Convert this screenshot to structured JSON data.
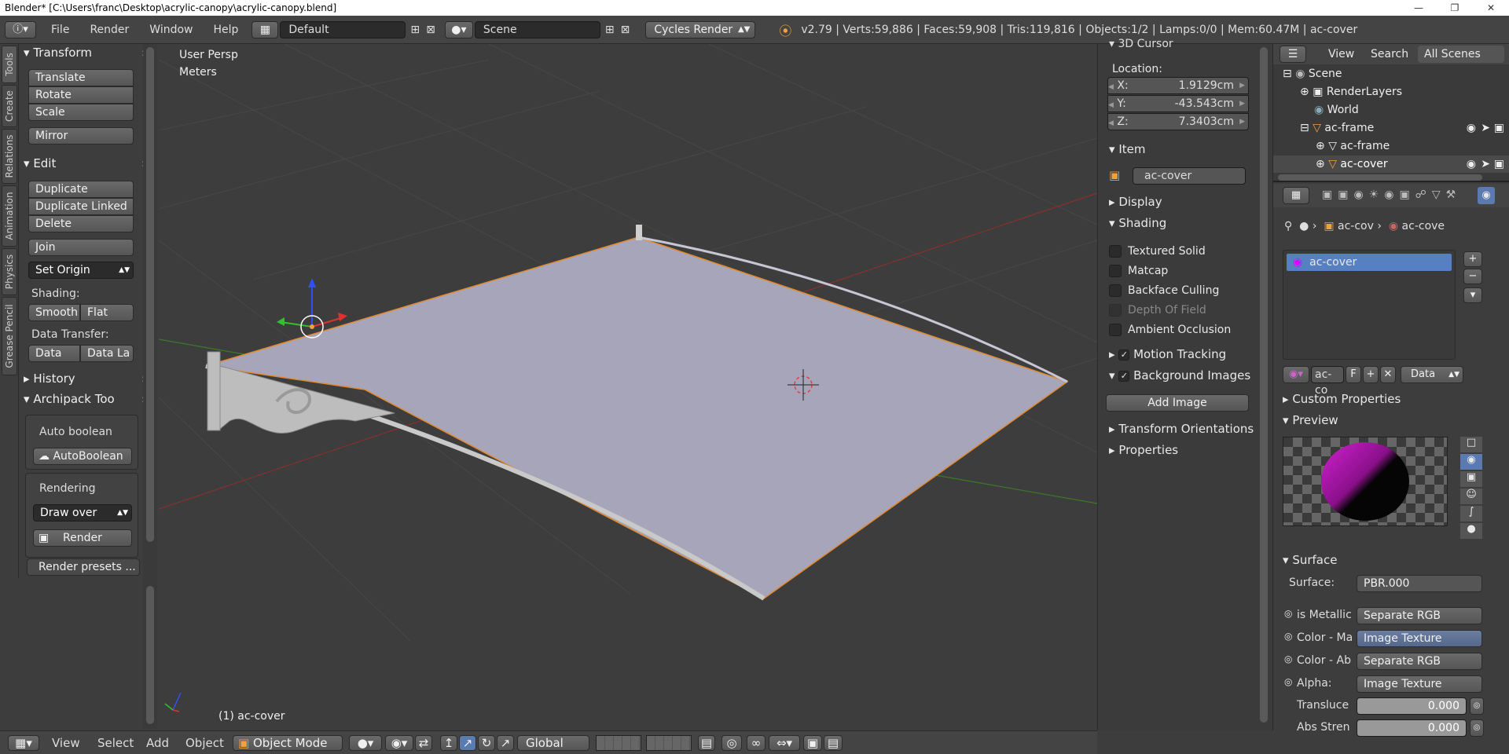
{
  "titlebar": {
    "text": "Blender* [C:\\Users\\franc\\Desktop\\acrylic-canopy\\acrylic-canopy.blend]"
  },
  "info": {
    "menus": [
      "File",
      "Render",
      "Window",
      "Help"
    ],
    "layout": "Default",
    "scene": "Scene",
    "engine": "Cycles Render",
    "stats": "v2.79 | Verts:59,886 | Faces:59,908 | Tris:119,816 | Objects:1/2 | Lamps:0/0 | Mem:60.47M | ac-cover"
  },
  "tabs": [
    "Tools",
    "Create",
    "Relations",
    "Animation",
    "Physics",
    "Grease Pencil"
  ],
  "toolshelf": {
    "transform": {
      "title": "Transform",
      "buttons": [
        "Translate",
        "Rotate",
        "Scale",
        "Mirror"
      ]
    },
    "edit": {
      "title": "Edit",
      "buttons": [
        "Duplicate",
        "Duplicate Linked",
        "Delete",
        "Join"
      ],
      "set_origin": "Set Origin",
      "shading_label": "Shading:",
      "smooth": "Smooth",
      "flat": "Flat",
      "transfer_label": "Data Transfer:",
      "data": "Data",
      "data_la": "Data La"
    },
    "history": "History",
    "archipack": {
      "title": "Archipack Too",
      "auto_label": "Auto boolean",
      "auto_btn": "AutoBoolean",
      "render_label": "Rendering",
      "draw_over": "Draw over",
      "render_btn": "Render",
      "presets": "Render presets ..."
    }
  },
  "viewport": {
    "persp": "User Persp",
    "units": "Meters",
    "object": "(1) ac-cover"
  },
  "npanel": {
    "cursor_title": "3D Cursor",
    "location": "Location:",
    "x_label": "X:",
    "x": "1.9129cm",
    "y_label": "Y:",
    "y": "-43.543cm",
    "z_label": "Z:",
    "z": "7.3403cm",
    "item": "Item",
    "item_name": "ac-cover",
    "display": "Display",
    "shading": "Shading",
    "checks": [
      "Textured Solid",
      "Matcap",
      "Backface Culling",
      "Depth Of Field",
      "Ambient Occlusion"
    ],
    "motion": "Motion Tracking",
    "bg": "Background Images",
    "add_image": "Add Image",
    "transform_or": "Transform Orientations",
    "properties": "Properties"
  },
  "outliner": {
    "view": "View",
    "search": "Search",
    "all_scenes": "All Scenes",
    "rows": [
      "Scene",
      "RenderLayers",
      "World",
      "ac-frame",
      "ac-frame",
      "ac-cover"
    ]
  },
  "props": {
    "crumb1": "ac-cov",
    "crumb2": "ac-cove",
    "slot": "ac-cover",
    "mat_name": "ac-co",
    "f": "F",
    "data": "Data",
    "custom": "Custom Properties",
    "preview": "Preview",
    "surface_title": "Surface",
    "surface_label": "Surface:",
    "surface_val": "PBR.000",
    "rows": [
      {
        "label": "is Metallic",
        "value": "Separate RGB"
      },
      {
        "label": "Color - Ma",
        "value": "Image Texture"
      },
      {
        "label": "Color - Ab",
        "value": "Separate RGB"
      },
      {
        "label": "Alpha:",
        "value": "Image Texture"
      }
    ],
    "transluce": "Transluce",
    "transluce_val": "0.000",
    "absstren": "Abs Stren",
    "absstren_val": "0.000"
  },
  "footer": {
    "view": "View",
    "select": "Select",
    "add": "Add",
    "object": "Object",
    "mode": "Object Mode",
    "orient": "Global"
  }
}
